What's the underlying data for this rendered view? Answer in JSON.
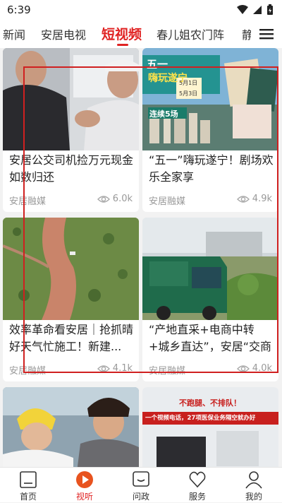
{
  "status": {
    "time": "6:39"
  },
  "tabs": [
    "新闻",
    "安居电视",
    "短视频",
    "春儿姐农门阵",
    "静"
  ],
  "feed": {
    "cards": [
      {
        "title": "安居公交司机捡万元现金如数归还",
        "source": "安居融媒",
        "views": "6.0k"
      },
      {
        "title": "“五一”嗨玩遂宁！剧场欢乐全家享",
        "source": "安居融媒",
        "views": "4.9k"
      },
      {
        "title": "效率革命看安居｜抢抓晴好天气忙施工！新建...",
        "source": "安居融媒",
        "views": "4.1k"
      },
      {
        "title": "“产地直采+电商中转+城乡直达”，安居“交商邮...",
        "source": "安居融媒",
        "views": "4.0k"
      }
    ],
    "thumb_text": {
      "card2_banner1": "五一",
      "card2_banner2": "嗨玩遂宁",
      "card2_date1": "5月1日",
      "card2_date2": "5月3日",
      "card2_badge": "连续5场",
      "card6_banner1": "不跑腿、不排队！",
      "card6_banner2": "一个视频电话，27项医保业务隔空就办好"
    }
  },
  "nav": [
    {
      "label": "首页"
    },
    {
      "label": "视听"
    },
    {
      "label": "问政"
    },
    {
      "label": "服务"
    },
    {
      "label": "我的"
    }
  ],
  "colors": {
    "accent": "#e02323"
  }
}
